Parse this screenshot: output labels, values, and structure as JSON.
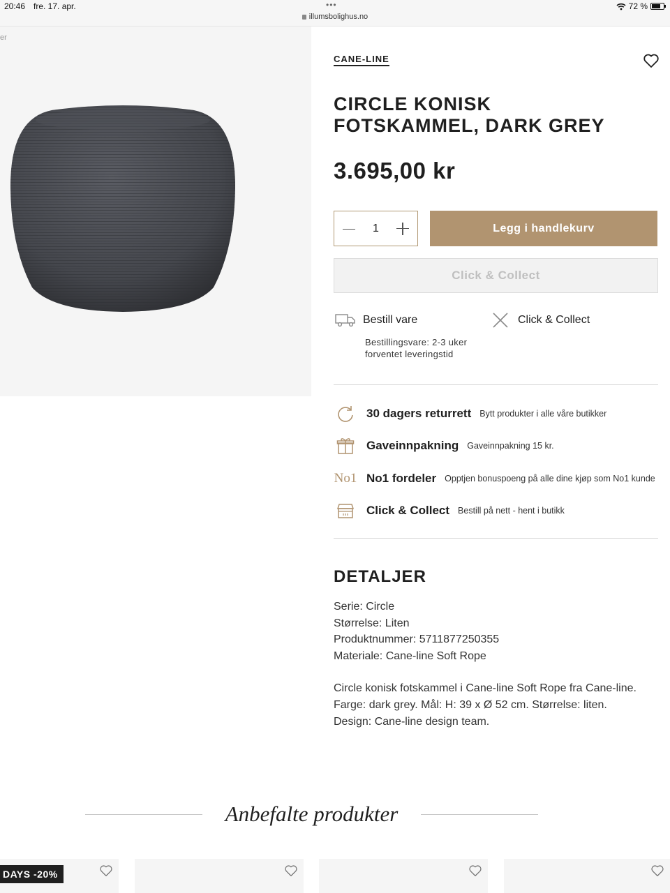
{
  "status_bar": {
    "time": "20:46",
    "date": "fre. 17. apr.",
    "url": "illumsbolighus.no",
    "battery": "72 %",
    "battery_level": 0.72
  },
  "breadcrumb_fragment": "er",
  "product": {
    "brand": "CANE-LINE",
    "title_line1": "CIRCLE KONISK",
    "title_line2": "FOTSKAMMEL, DARK GREY",
    "price": "3.695,00 kr",
    "image_color": "#4a4c52"
  },
  "quantity": {
    "value": "1"
  },
  "buttons": {
    "add_to_cart": "Legg i handlekurv",
    "click_collect": "Click & Collect"
  },
  "delivery": {
    "order_title": "Bestill vare",
    "order_sub": "Bestillingsvare: 2-3 uker forventet leveringstid",
    "pickup_title": "Click & Collect"
  },
  "usps": [
    {
      "icon": "return-icon",
      "title": "30 dagers returrett",
      "sub": "Bytt produkter i alle våre butikker"
    },
    {
      "icon": "gift-icon",
      "title": "Gaveinnpakning",
      "sub": "Gaveinnpakning 15 kr."
    },
    {
      "icon": "no1-icon",
      "icon_text": "No1",
      "title": "No1 fordeler",
      "sub": "Opptjen bonuspoeng på alle dine kjøp som No1 kunde"
    },
    {
      "icon": "store-icon",
      "title": "Click & Collect",
      "sub": "Bestill på nett - hent i butikk"
    }
  ],
  "details": {
    "heading": "DETALJER",
    "specs": [
      "Serie: Circle",
      "Størrelse: Liten",
      "Produktnummer: 5711877250355",
      "Materiale: Cane-line Soft Rope"
    ],
    "description": "Circle konisk fotskammel i Cane-line Soft Rope fra Cane-line. Farge: dark grey. Mål: H: 39 x Ø 52 cm. Størrelse: liten. Design: Cane-line design team."
  },
  "recommended": {
    "heading": "Anbefalte produkter",
    "badge": "DAYS -20%"
  },
  "colors": {
    "accent": "#b19470",
    "text": "#1f1f1f"
  }
}
